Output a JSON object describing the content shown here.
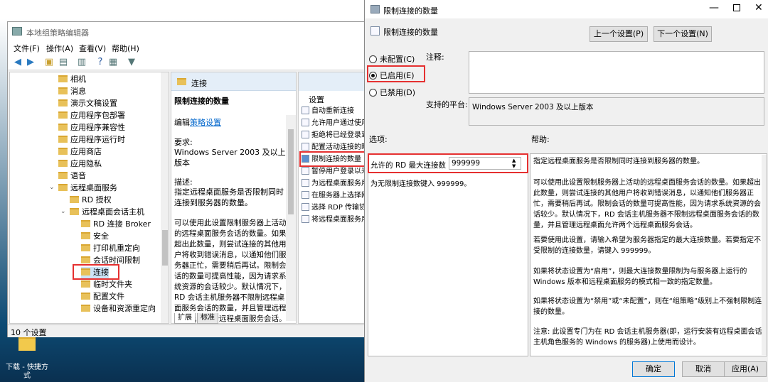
{
  "gpedit": {
    "title": "本地组策略编辑器",
    "menus": [
      "文件(F)",
      "操作(A)",
      "查看(V)",
      "帮助(H)"
    ],
    "tree_items": [
      "相机",
      "消息",
      "演示文稿设置",
      "应用程序包部署",
      "应用程序兼容性",
      "应用程序运行时",
      "应用商店",
      "应用隐私",
      "语音",
      "远程桌面服务",
      "RD 授权",
      "远程桌面会话主机",
      "RD 连接 Broker",
      "安全",
      "打印机重定向",
      "会话时间限制",
      "连接",
      "临时文件夹",
      "配置文件",
      "设备和资源重定向"
    ],
    "desc_header": "连接",
    "desc_title": "限制连接的数量",
    "desc_edit_prefix": "编辑",
    "desc_edit_link": "策略设置",
    "desc_req_label": "要求:",
    "desc_req_value": "Windows Server 2003 及以上版本",
    "desc_label": "描述:",
    "desc_text1": "指定远程桌面服务是否限制同时连接到服务器的数量。",
    "desc_text2": "可以使用此设置限制服务器上活动的远程桌面服务会话的数量。如果超出此数量，则尝试连接的其他用户将收到错误消息，以通知他们服务器正忙，需要稍后再试。限制会话的数量可提高性能，因为请求系统资源的会话较少。默认情况下，RD 会话主机服务器不限制远程桌面服务会话的数量，并且管理远程桌面允许两个远程桌面服务会话。",
    "settings_header": "设置",
    "settings": [
      "自动重新连接",
      "允许用户通过使用",
      "拒绝将已经登录到",
      "配置活动连接的时",
      "限制连接的数量",
      "暂停用户登录以来",
      "为远程桌面服务用",
      "在服务器上选择网",
      "选择 RDP 传输协",
      "将远程桌面服务用"
    ],
    "tabs": [
      "扩展",
      "标准"
    ],
    "status": "10 个设置"
  },
  "desktop": {
    "shortcut_label": "下载 - 快捷方式"
  },
  "dialog": {
    "title": "限制连接的数量",
    "header": "限制连接的数量",
    "prev_button": "上一个设置(P)",
    "next_button": "下一个设置(N)",
    "radio_not_configured": "未配置(C)",
    "radio_enabled": "已启用(E)",
    "radio_disabled": "已禁用(D)",
    "comment_label": "注释:",
    "platform_label": "支持的平台:",
    "platform_value": "Windows Server 2003 及以上版本",
    "options_label": "选项:",
    "help_label": "帮助:",
    "max_conn_label": "允许的 RD 最大连接数",
    "max_conn_value": "999999",
    "unlimited_hint": "为无限制连接数键入 999999。",
    "help_paragraphs": [
      "指定远程桌面服务是否限制同时连接到服务器的数量。",
      "可以使用此设置限制服务器上活动的远程桌面服务会话的数量。如果超出此数量，则尝试连接的其他用户将收到错误消息，以通知他们服务器正忙，需要稍后再试。限制会话的数量可提高性能，因为请求系统资源的会话较少。默认情况下，RD 会话主机服务器不限制远程桌面服务会话的数量，并且管理远程桌面允许两个远程桌面服务会话。",
      "若要使用此设置，请输入希望为服务器指定的最大连接数量。若要指定不受限制的连接数量，请键入 999999。",
      "如果将状态设置为“启用”，则最大连接数量限制为与服务器上运行的 Windows 版本和远程桌面服务的模式相一致的指定数量。",
      "如果将状态设置为“禁用”或“未配置”，则在“组策略”级别上不强制限制连接的数量。",
      "注意: 此设置专门为在 RD 会话主机服务器(即，运行安装有远程桌面会话主机角色服务的 Windows 的服务器)上使用而设计。"
    ],
    "ok_button": "确定",
    "cancel_button": "取消",
    "apply_button": "应用(A)"
  },
  "colors": {
    "highlight": "#e53030",
    "link": "#0066cc",
    "window_bg": "#f0f0f0"
  }
}
